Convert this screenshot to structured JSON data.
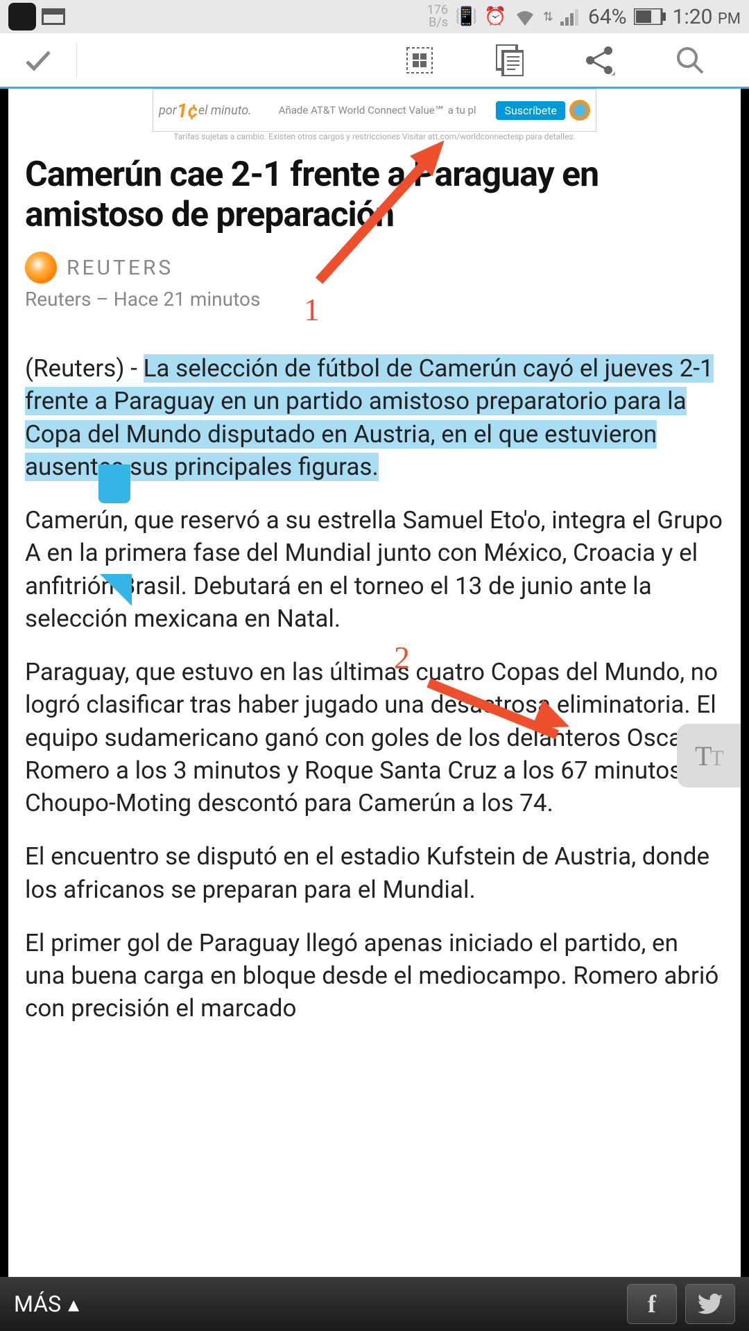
{
  "status": {
    "bytes_top": "176",
    "bytes_bottom": "B/s",
    "battery": "64%",
    "time": "1:20",
    "ampm": "PM"
  },
  "annotations": {
    "label1": "1",
    "label2": "2"
  },
  "floating": {
    "label": "T"
  },
  "ad": {
    "por": "por",
    "price": "1¢",
    "min": "el minuto.",
    "text": "Añade AT&T World Connect Value℠ a tu pl",
    "cta": "Suscríbete",
    "disclaimer": "Tarifas sujetas a cambio. Existen otros cargos y restricciones Visitar att.com/worldconnectesp para detalles."
  },
  "article": {
    "headline": "Camerún cae 2-1 frente a Paraguay en amistoso de preparación",
    "source_label": "REUTERS",
    "byline": "Reuters – Hace 21 minutos",
    "p1_prefix": "(Reuters) - ",
    "p1_highlight": "La selección de fútbol de Camerún cayó el jueves 2-1 frente a Paraguay en un partido amistoso preparatorio para la Copa del Mundo disputado en Austria, en el que estuvieron ausentes sus principales figuras.",
    "p2": "Camerún, que reservó a su estrella Samuel Eto'o, integra el Grupo A en la primera fase del Mundial junto con México, Croacia y el anfitrión Brasil. Debutará en el torneo el 13 de junio ante la selección mexicana en Natal.",
    "p3": "Paraguay, que estuvo en las últimas cuatro Copas del Mundo, no logró clasificar tras haber jugado una desastrosa eliminatoria. El equipo sudamericano ganó con goles de los delanteros Oscar Romero a los 3 minutos y Roque Santa Cruz a los 67 minutos. Choupo-Moting descontó para Camerún a los 74.",
    "p4": "El encuentro se disputó en el estadio Kufstein de Austria, donde los africanos se preparan para el Mundial.",
    "p5": "El primer gol de Paraguay llegó apenas iniciado el partido, en una buena carga en bloque desde el mediocampo. Romero abrió con precisión el marcado"
  },
  "bottom": {
    "mas": "MÁS",
    "fb": "f",
    "tw": "🐦"
  }
}
